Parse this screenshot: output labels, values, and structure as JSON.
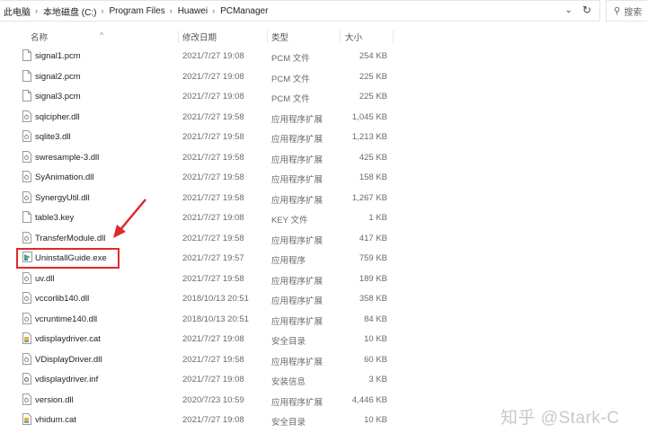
{
  "address_bar": {
    "crumbs": [
      "此电脑",
      "本地磁盘 (C:)",
      "Program Files",
      "Huawei",
      "PCManager"
    ],
    "search_placeholder": "搜索"
  },
  "columns": {
    "name": "名称",
    "date": "修改日期",
    "type": "类型",
    "size": "大小"
  },
  "files": [
    {
      "name": "signal1.pcm",
      "date": "2021/7/27 19:08",
      "type": "PCM 文件",
      "size": "254 KB",
      "icon": "file-icon"
    },
    {
      "name": "signal2.pcm",
      "date": "2021/7/27 19:08",
      "type": "PCM 文件",
      "size": "225 KB",
      "icon": "file-icon"
    },
    {
      "name": "signal3.pcm",
      "date": "2021/7/27 19:08",
      "type": "PCM 文件",
      "size": "225 KB",
      "icon": "file-icon"
    },
    {
      "name": "sqlcipher.dll",
      "date": "2021/7/27 19:58",
      "type": "应用程序扩展",
      "size": "1,045 KB",
      "icon": "dll-icon"
    },
    {
      "name": "sqlite3.dll",
      "date": "2021/7/27 19:58",
      "type": "应用程序扩展",
      "size": "1,213 KB",
      "icon": "dll-icon"
    },
    {
      "name": "swresample-3.dll",
      "date": "2021/7/27 19:58",
      "type": "应用程序扩展",
      "size": "425 KB",
      "icon": "dll-icon"
    },
    {
      "name": "SyAnimation.dll",
      "date": "2021/7/27 19:58",
      "type": "应用程序扩展",
      "size": "158 KB",
      "icon": "dll-icon"
    },
    {
      "name": "SynergyUtil.dll",
      "date": "2021/7/27 19:58",
      "type": "应用程序扩展",
      "size": "1,267 KB",
      "icon": "dll-icon"
    },
    {
      "name": "table3.key",
      "date": "2021/7/27 19:08",
      "type": "KEY 文件",
      "size": "1 KB",
      "icon": "file-icon"
    },
    {
      "name": "TransferModule.dll",
      "date": "2021/7/27 19:58",
      "type": "应用程序扩展",
      "size": "417 KB",
      "icon": "dll-icon"
    },
    {
      "name": "UninstallGuide.exe",
      "date": "2021/7/27 19:57",
      "type": "应用程序",
      "size": "759 KB",
      "icon": "exe-icon"
    },
    {
      "name": "uv.dll",
      "date": "2021/7/27 19:58",
      "type": "应用程序扩展",
      "size": "189 KB",
      "icon": "dll-icon"
    },
    {
      "name": "vccorlib140.dll",
      "date": "2018/10/13 20:51",
      "type": "应用程序扩展",
      "size": "358 KB",
      "icon": "dll-icon"
    },
    {
      "name": "vcruntime140.dll",
      "date": "2018/10/13 20:51",
      "type": "应用程序扩展",
      "size": "84 KB",
      "icon": "dll-icon"
    },
    {
      "name": "vdisplaydriver.cat",
      "date": "2021/7/27 19:08",
      "type": "安全目录",
      "size": "10 KB",
      "icon": "catalog-icon"
    },
    {
      "name": "VDisplayDriver.dll",
      "date": "2021/7/27 19:58",
      "type": "应用程序扩展",
      "size": "60 KB",
      "icon": "dll-icon"
    },
    {
      "name": "vdisplaydriver.inf",
      "date": "2021/7/27 19:08",
      "type": "安装信息",
      "size": "3 KB",
      "icon": "inf-icon"
    },
    {
      "name": "version.dll",
      "date": "2020/7/23 10:59",
      "type": "应用程序扩展",
      "size": "4,446 KB",
      "icon": "dll-icon"
    },
    {
      "name": "vhidum.cat",
      "date": "2021/7/27 19:08",
      "type": "安全目录",
      "size": "10 KB",
      "icon": "catalog-icon"
    }
  ],
  "watermark": "知乎 @Stark-C",
  "colors": {
    "highlight": "#e0292b",
    "arrow": "#e0292b"
  }
}
